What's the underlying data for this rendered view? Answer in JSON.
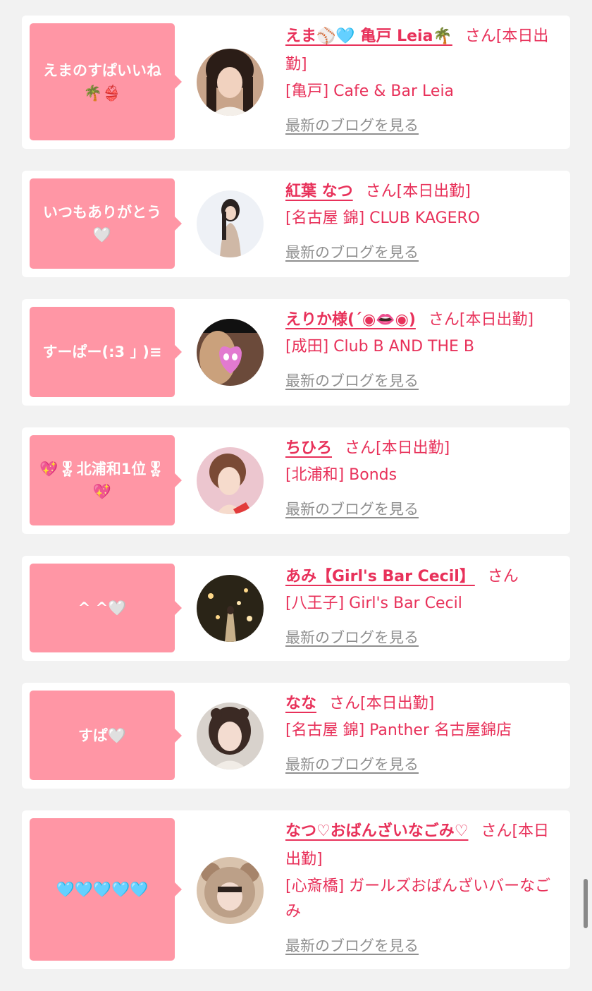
{
  "colors": {
    "accent": "#e8315a",
    "bubble": "#ff96a5",
    "link_gray": "#8f8f8f",
    "background": "#f2f2f2"
  },
  "posts": [
    {
      "comment": "えまのすぱいいね🌴👙",
      "name": "えま⚾🩵 亀戸 Leia🌴",
      "san": "さん[本日出勤]",
      "shop": "[亀戸] Cafe & Bar Leia",
      "blog_link": "最新のブログを見る"
    },
    {
      "comment": "いつもありがとう🤍",
      "name": "紅葉 なつ",
      "san": "さん[本日出勤]",
      "shop": "[名古屋 錦] CLUB KAGERO",
      "blog_link": "最新のブログを見る"
    },
    {
      "comment": "すーぱー(:3 ｣ )≡",
      "name": "えりか様(´◉👄◉)",
      "san": "さん[本日出勤]",
      "shop": "[成田] Club B AND THE B",
      "blog_link": "最新のブログを見る"
    },
    {
      "comment": "💖🎖北浦和1位🎖💖",
      "name": "ちひろ",
      "san": "さん[本日出勤]",
      "shop": "[北浦和] Bonds",
      "blog_link": "最新のブログを見る"
    },
    {
      "comment": "^ ^🤍",
      "name": "あみ【Girl's Bar Cecil】",
      "san": "さん",
      "shop": "[八王子] Girl's Bar Cecil",
      "blog_link": "最新のブログを見る"
    },
    {
      "comment": "すぱ🤍",
      "name": "なな",
      "san": "さん[本日出勤]",
      "shop": "[名古屋 錦] Panther 名古屋錦店",
      "blog_link": "最新のブログを見る"
    },
    {
      "comment": "🩵🩵🩵🩵🩵",
      "name": "なつ♡おばんざいなごみ♡",
      "san": "さん[本日出勤]",
      "shop": "[心斎橋] ガールズおばんざいバーなごみ",
      "blog_link": "最新のブログを見る"
    }
  ]
}
